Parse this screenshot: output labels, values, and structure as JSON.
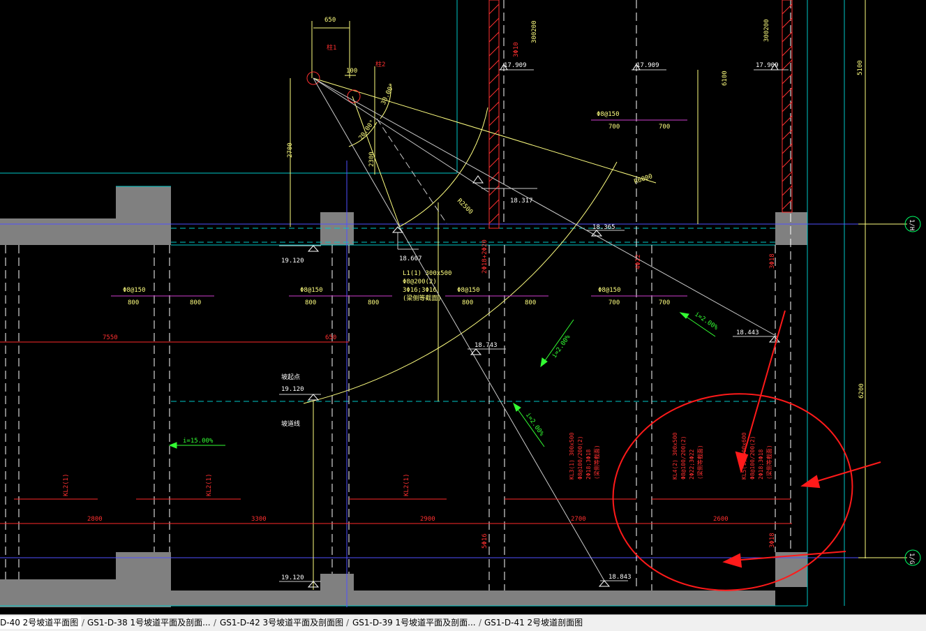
{
  "colors": {
    "background": "#000000",
    "wall_fill": "#808080",
    "axis_cyan": "#00c8c8",
    "grid_blue": "#4a4aff",
    "dim_yellow": "#ffff80",
    "annot_red": "#ff2a2a",
    "slope_green": "#33ff33",
    "rebar_magenta": "#d040d0",
    "arrow_red": "#ff1a1a"
  },
  "drawing": {
    "top_dims": {
      "d650": "650",
      "d100": "100",
      "d2700": "2700",
      "d2300": "2300",
      "d6100": "6100",
      "d5100": "5100",
      "d6200": "6200"
    },
    "col_labels": {
      "zhu1": "柱1",
      "zhu2": "柱2",
      "angle30": "30.00°",
      "angle20": "20.00°"
    },
    "radii": {
      "r6000": "R6000",
      "r2500": "R2500"
    },
    "elevations": {
      "e17909a": "17.909",
      "e17909b": "17.909",
      "e17909c": "17.909",
      "e18317": "18.317",
      "e18365": "18.365",
      "e18607": "18.607",
      "e19120a": "19.120",
      "e19120b": "19.120",
      "e19120c": "19.120",
      "e18743": "18.743",
      "e18443": "18.443",
      "e18843": "18.843"
    },
    "top_walls": {
      "wall_a": "300200",
      "wall_b": "300200",
      "bar_a": "3Φ10"
    },
    "rebar": {
      "r1": "Φ8@150",
      "r2": "Φ8@150",
      "r3": "Φ8@150",
      "r4": "Φ8@150",
      "r5": "Φ8@150"
    },
    "spans": {
      "s800a": "800",
      "s800b": "800",
      "s800c": "800",
      "s800d": "800",
      "s800e": "800",
      "s800f": "800",
      "s700a": "700",
      "s700b": "700",
      "s700c": "700",
      "s700d": "700"
    },
    "beam_l1": {
      "line1": "L1(1) 300x500",
      "line2": "Φ8@200(2)",
      "line3": "3Φ16;3Φ16",
      "line4": "(梁侧等截面)"
    },
    "slopes": {
      "sl1": "i=2.00%",
      "sl2": "i=2.00%",
      "sl3": "i=2.00%",
      "sl4": "i=15.00%"
    },
    "dims_mid": {
      "d7550": "7550",
      "d650b": "650"
    },
    "dims_bottom": {
      "d2800": "2800",
      "d3300": "3300",
      "d2900": "2900",
      "d2700b": "2700",
      "d2600": "2600"
    },
    "kl_labels": {
      "k1": "KL2(1)",
      "k2": "KL2(1)",
      "k3": "KL2(1)"
    },
    "kl_blocks": {
      "kl3": [
        "KL3(1) 300x500",
        "Φ8@100/200(2)",
        "2Φ18;3Φ18",
        "(梁侧等截面)"
      ],
      "kl4": [
        "KL4(2) 300x500",
        "Φ8@100/200(2)",
        "2Φ22;3Φ22",
        "(梁侧等截面)"
      ],
      "kl5": [
        "KL5(1) 300x600",
        "Φ8@100/200(2)",
        "2Φ18;3Φ18",
        "(梁侧等截面)"
      ]
    },
    "misc": {
      "bar3f8a": "3Φ18",
      "bar3f8b": "3Φ18",
      "bar4f22": "4Φ22",
      "bar5f16": "5Φ16",
      "nixian1": "坡起点",
      "nixian2": "坡道线"
    },
    "axes": {
      "ax1": "1/H",
      "ax2": "1/G"
    }
  },
  "tabs": [
    {
      "label": "D-40 2号坡道平面图",
      "active": true
    },
    {
      "label": "GS1-D-38 1号坡道平面及剖面...",
      "active": false
    },
    {
      "label": "GS1-D-42 3号坡道平面及剖面图",
      "active": false
    },
    {
      "label": "GS1-D-39 1号坡道平面及剖面...",
      "active": false
    },
    {
      "label": "GS1-D-41 2号坡道剖面图",
      "active": false
    }
  ]
}
